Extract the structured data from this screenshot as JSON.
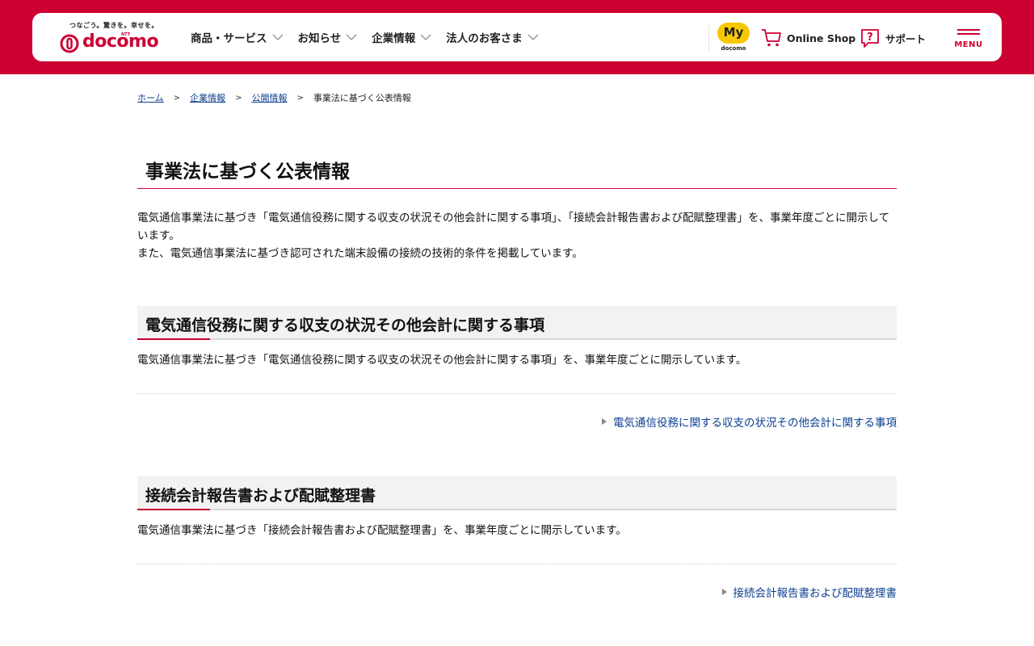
{
  "brand": {
    "tagline": "つなごう。驚きを。幸せを。",
    "ntt": "NTT",
    "name": "docomo",
    "color": "#cc0033"
  },
  "header": {
    "nav": [
      {
        "label": "商品・サービス",
        "icon": "chevron-down-icon"
      },
      {
        "label": "お知らせ",
        "icon": "chevron-down-icon"
      },
      {
        "label": "企業情報",
        "icon": "chevron-down-icon"
      },
      {
        "label": "法人のお客さま",
        "icon": "chevron-down-icon"
      }
    ],
    "my": {
      "label": "My",
      "sub": "docomo"
    },
    "online_shop": "Online Shop",
    "support": "サポート",
    "menu": "MENU"
  },
  "breadcrumb": [
    {
      "label": "ホーム",
      "link": true
    },
    {
      "label": "企業情報",
      "link": true
    },
    {
      "label": "公開情報",
      "link": true
    },
    {
      "label": "事業法に基づく公表情報",
      "link": false
    }
  ],
  "breadcrumb_sep": ">",
  "page": {
    "title": "事業法に基づく公表情報",
    "lead_1": "電気通信事業法に基づき「電気通信役務に関する収支の状況その他会計に関する事項」、「接続会計報告書および配賦整理書」を、事業年度ごとに開示しています。",
    "lead_2": "また、電気通信事業法に基づき認可された端末設備の接続の技術的条件を掲載しています。"
  },
  "sections": [
    {
      "heading": "電気通信役務に関する収支の状況その他会計に関する事項",
      "text": "電気通信事業法に基づき「電気通信役務に関する収支の状況その他会計に関する事項」を、事業年度ごとに開示しています。",
      "link": "電気通信役務に関する収支の状況その他会計に関する事項"
    },
    {
      "heading": "接続会計報告書および配賦整理書",
      "text": "電気通信事業法に基づき「接続会計報告書および配賦整理書」を、事業年度ごとに開示しています。",
      "link": "接続会計報告書および配賦整理書"
    }
  ]
}
